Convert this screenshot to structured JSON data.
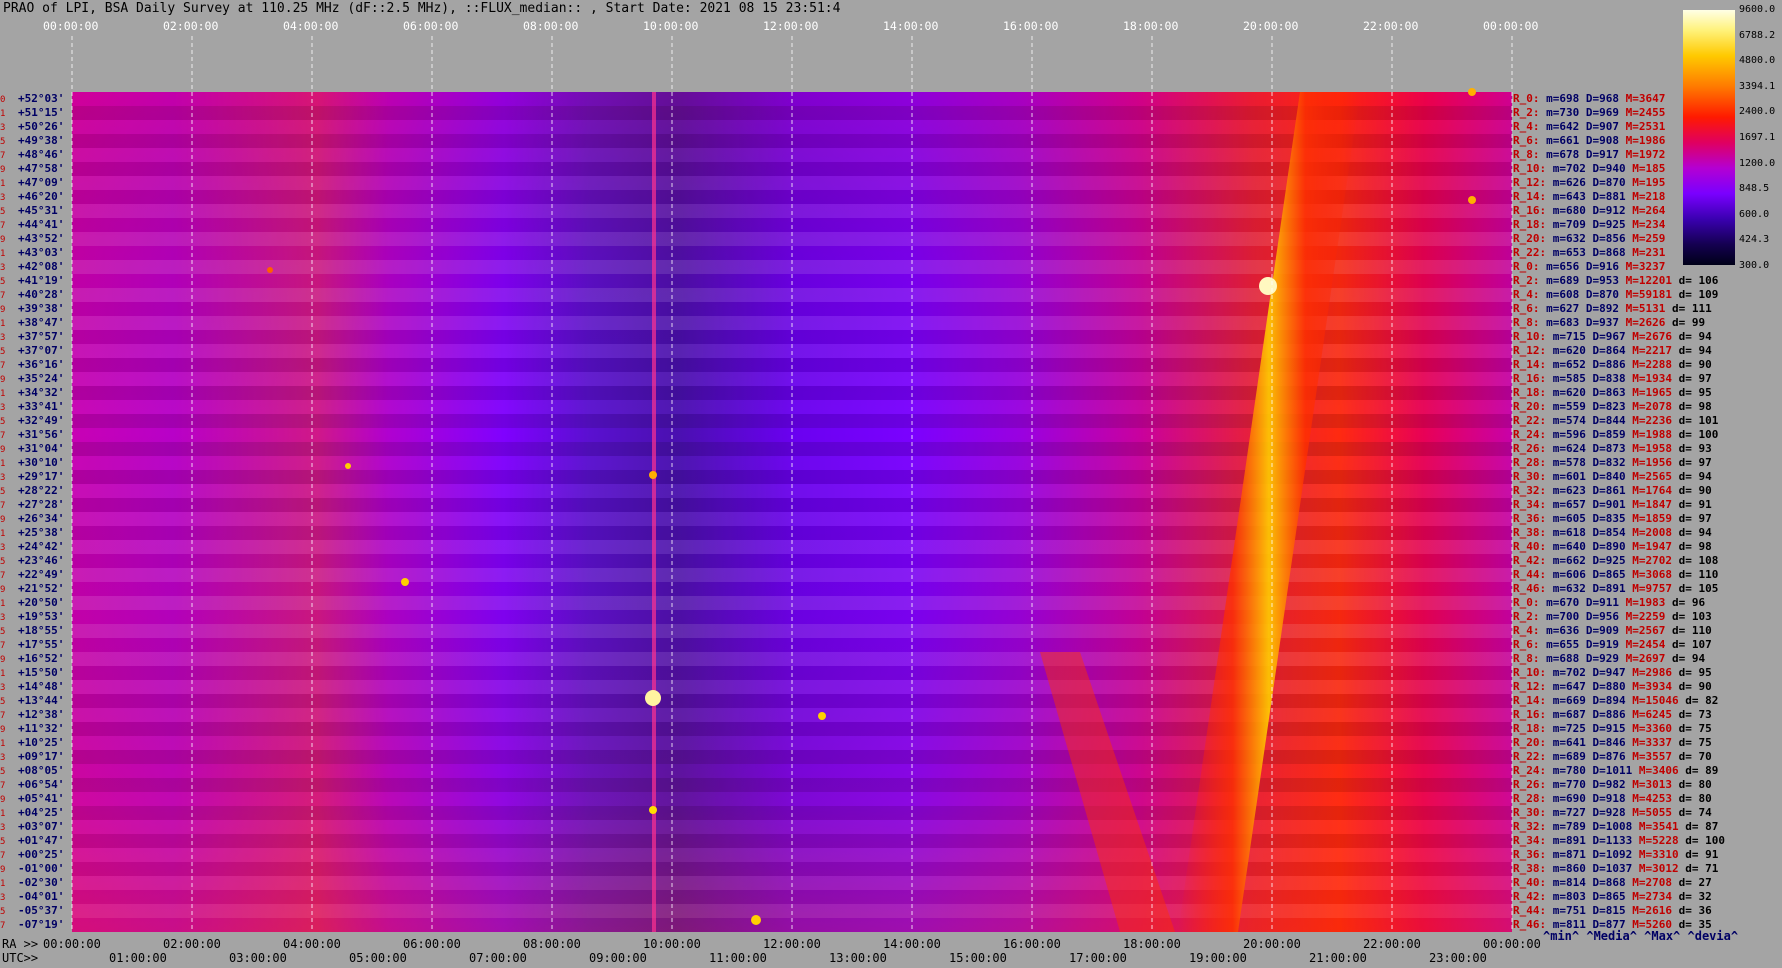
{
  "title": "PRAO of LPI, BSA Daily Survey at 110.25 MHz (dF::2.5 MHz), ::FLUX_median:: , Start Date: 2021 08 15 23:51:4",
  "chart_data": {
    "type": "heatmap",
    "title": "PRAO of LPI, BSA Daily Survey at 110.25 MHz (dF::2.5 MHz), ::FLUX_median:: , Start Date: 2021 08 15 23:51:4",
    "top_time_ticks": [
      "00:00:00",
      "02:00:00",
      "04:00:00",
      "06:00:00",
      "08:00:00",
      "10:00:00",
      "12:00:00",
      "14:00:00",
      "16:00:00",
      "18:00:00",
      "20:00:00",
      "22:00:00",
      "00:00:00"
    ],
    "bottom_ra_ticks": [
      "00:00:00",
      "02:00:00",
      "04:00:00",
      "06:00:00",
      "08:00:00",
      "10:00:00",
      "12:00:00",
      "14:00:00",
      "16:00:00",
      "18:00:00",
      "20:00:00",
      "22:00:00",
      "00:00:00"
    ],
    "bottom_utc_ticks": [
      "01:00:00",
      "03:00:00",
      "05:00:00",
      "07:00:00",
      "09:00:00",
      "11:00:00",
      "13:00:00",
      "15:00:00",
      "17:00:00",
      "19:00:00",
      "21:00:00",
      "23:00:00"
    ],
    "ra_axis_label": "RA >>",
    "utc_axis_label": "UTC>>",
    "colorbar_ticks": [
      "9600.0",
      "6788.2",
      "4800.0",
      "3394.1",
      "2400.0",
      "1697.1",
      "1200.0",
      "848.5",
      "600.0",
      "424.3",
      "300.0"
    ],
    "colorscale": [
      "#000018",
      "#3a00b0",
      "#7a00ff",
      "#b400d2",
      "#e00060",
      "#ff1a00",
      "#ff7a00",
      "#ffc900",
      "#fff27a",
      "#ffffe6"
    ],
    "row_indices": [
      "0",
      "1",
      "3",
      "5",
      "7",
      "9",
      "1",
      "3",
      "5",
      "7",
      "9",
      "1",
      "3",
      "5",
      "7",
      "9",
      "1",
      "3",
      "5",
      "7",
      "9",
      "1",
      "3",
      "5",
      "7",
      "9",
      "1",
      "3",
      "5",
      "7",
      "9",
      "1",
      "3",
      "5",
      "7",
      "9",
      "1",
      "3",
      "5",
      "7",
      "9",
      "1",
      "3",
      "5",
      "7",
      "9",
      "1",
      "3",
      "5",
      "7",
      "9",
      "1",
      "3",
      "5",
      "7",
      "9",
      "1",
      "3",
      "5",
      "7",
      "9"
    ],
    "declinations": [
      "+52°03'",
      "+51°15'",
      "+50°26'",
      "+49°38'",
      "+48°46'",
      "+47°58'",
      "+47°09'",
      "+46°20'",
      "+45°31'",
      "+44°41'",
      "+43°52'",
      "+43°03'",
      "+42°08'",
      "+41°19'",
      "+40°28'",
      "+39°38'",
      "+38°47'",
      "+37°57'",
      "+37°07'",
      "+36°16'",
      "+35°24'",
      "+34°32'",
      "+33°41'",
      "+32°49'",
      "+31°56'",
      "+31°04'",
      "+30°10'",
      "+29°17'",
      "+28°22'",
      "+27°28'",
      "+26°34'",
      "+25°38'",
      "+24°42'",
      "+23°46'",
      "+22°49'",
      "+21°52'",
      "+20°50'",
      "+19°53'",
      "+18°55'",
      "+17°55'",
      "+16°52'",
      "+15°50'",
      "+14°48'",
      "+13°44'",
      "+12°38'",
      "+11°32'",
      "+10°25'",
      "+09°17'",
      "+08°05'",
      "+06°54'",
      "+05°41'",
      "+04°25'",
      "+03°07'",
      "+01°47'",
      "+00°25'",
      "-01°00'",
      "-02°30'",
      "-04°01'",
      "-05°37'",
      "-07°19'"
    ],
    "stats": [
      {
        "name": "R_0:",
        "min": "m=698",
        "med": "D=968",
        "max": "M=3647",
        "dev": ""
      },
      {
        "name": "R_2:",
        "min": "m=730",
        "med": "D=969",
        "max": "M=2455",
        "dev": ""
      },
      {
        "name": "R_4:",
        "min": "m=642",
        "med": "D=907",
        "max": "M=2531",
        "dev": ""
      },
      {
        "name": "R_6:",
        "min": "m=661",
        "med": "D=908",
        "max": "M=1986",
        "dev": ""
      },
      {
        "name": "R_8:",
        "min": "m=678",
        "med": "D=917",
        "max": "M=1972",
        "dev": ""
      },
      {
        "name": "R_10:",
        "min": "m=702",
        "med": "D=940",
        "max": "M=185",
        "dev": ""
      },
      {
        "name": "R_12:",
        "min": "m=626",
        "med": "D=870",
        "max": "M=195",
        "dev": ""
      },
      {
        "name": "R_14:",
        "min": "m=643",
        "med": "D=881",
        "max": "M=218",
        "dev": ""
      },
      {
        "name": "R_16:",
        "min": "m=680",
        "med": "D=912",
        "max": "M=264",
        "dev": ""
      },
      {
        "name": "R_18:",
        "min": "m=709",
        "med": "D=925",
        "max": "M=234",
        "dev": ""
      },
      {
        "name": "R_20:",
        "min": "m=632",
        "med": "D=856",
        "max": "M=259",
        "dev": ""
      },
      {
        "name": "R_22:",
        "min": "m=653",
        "med": "D=868",
        "max": "M=231",
        "dev": ""
      },
      {
        "name": "R_0:",
        "min": "m=656",
        "med": "D=916",
        "max": "M=3237",
        "dev": ""
      },
      {
        "name": "R_2:",
        "min": "m=689",
        "med": "D=953",
        "max": "M=12201",
        "dev": "d= 106"
      },
      {
        "name": "R_4:",
        "min": "m=608",
        "med": "D=870",
        "max": "M=59181",
        "dev": "d= 109"
      },
      {
        "name": "R_6:",
        "min": "m=627",
        "med": "D=892",
        "max": "M=5131",
        "dev": "d= 111"
      },
      {
        "name": "R_8:",
        "min": "m=683",
        "med": "D=937",
        "max": "M=2626",
        "dev": "d= 99"
      },
      {
        "name": "R_10:",
        "min": "m=715",
        "med": "D=967",
        "max": "M=2676",
        "dev": "d= 94"
      },
      {
        "name": "R_12:",
        "min": "m=620",
        "med": "D=864",
        "max": "M=2217",
        "dev": "d= 94"
      },
      {
        "name": "R_14:",
        "min": "m=652",
        "med": "D=886",
        "max": "M=2288",
        "dev": "d= 90"
      },
      {
        "name": "R_16:",
        "min": "m=585",
        "med": "D=838",
        "max": "M=1934",
        "dev": "d= 97"
      },
      {
        "name": "R_18:",
        "min": "m=620",
        "med": "D=863",
        "max": "M=1965",
        "dev": "d= 95"
      },
      {
        "name": "R_20:",
        "min": "m=559",
        "med": "D=823",
        "max": "M=2078",
        "dev": "d= 98"
      },
      {
        "name": "R_22:",
        "min": "m=574",
        "med": "D=844",
        "max": "M=2236",
        "dev": "d= 101"
      },
      {
        "name": "R_24:",
        "min": "m=596",
        "med": "D=859",
        "max": "M=1988",
        "dev": "d= 100"
      },
      {
        "name": "R_26:",
        "min": "m=624",
        "med": "D=873",
        "max": "M=1958",
        "dev": "d= 93"
      },
      {
        "name": "R_28:",
        "min": "m=578",
        "med": "D=832",
        "max": "M=1956",
        "dev": "d= 97"
      },
      {
        "name": "R_30:",
        "min": "m=601",
        "med": "D=840",
        "max": "M=2565",
        "dev": "d= 94"
      },
      {
        "name": "R_32:",
        "min": "m=623",
        "med": "D=861",
        "max": "M=1764",
        "dev": "d= 90"
      },
      {
        "name": "R_34:",
        "min": "m=657",
        "med": "D=901",
        "max": "M=1847",
        "dev": "d= 91"
      },
      {
        "name": "R_36:",
        "min": "m=605",
        "med": "D=835",
        "max": "M=1859",
        "dev": "d= 97"
      },
      {
        "name": "R_38:",
        "min": "m=618",
        "med": "D=854",
        "max": "M=2008",
        "dev": "d= 94"
      },
      {
        "name": "R_40:",
        "min": "m=640",
        "med": "D=890",
        "max": "M=1947",
        "dev": "d= 98"
      },
      {
        "name": "R_42:",
        "min": "m=662",
        "med": "D=925",
        "max": "M=2702",
        "dev": "d= 108"
      },
      {
        "name": "R_44:",
        "min": "m=606",
        "med": "D=865",
        "max": "M=3068",
        "dev": "d= 110"
      },
      {
        "name": "R_46:",
        "min": "m=632",
        "med": "D=891",
        "max": "M=9757",
        "dev": "d= 105"
      },
      {
        "name": "R_0:",
        "min": "m=670",
        "med": "D=911",
        "max": "M=1983",
        "dev": "d= 96"
      },
      {
        "name": "R_2:",
        "min": "m=700",
        "med": "D=956",
        "max": "M=2259",
        "dev": "d= 103"
      },
      {
        "name": "R_4:",
        "min": "m=636",
        "med": "D=909",
        "max": "M=2567",
        "dev": "d= 110"
      },
      {
        "name": "R_6:",
        "min": "m=655",
        "med": "D=919",
        "max": "M=2454",
        "dev": "d= 107"
      },
      {
        "name": "R_8:",
        "min": "m=688",
        "med": "D=929",
        "max": "M=2697",
        "dev": "d= 94"
      },
      {
        "name": "R_10:",
        "min": "m=702",
        "med": "D=947",
        "max": "M=2986",
        "dev": "d= 95"
      },
      {
        "name": "R_12:",
        "min": "m=647",
        "med": "D=880",
        "max": "M=3934",
        "dev": "d= 90"
      },
      {
        "name": "R_14:",
        "min": "m=669",
        "med": "D=894",
        "max": "M=15046",
        "dev": "d= 82"
      },
      {
        "name": "R_16:",
        "min": "m=687",
        "med": "D=886",
        "max": "M=6245",
        "dev": "d= 73"
      },
      {
        "name": "R_18:",
        "min": "m=725",
        "med": "D=915",
        "max": "M=3360",
        "dev": "d= 75"
      },
      {
        "name": "R_20:",
        "min": "m=641",
        "med": "D=846",
        "max": "M=3337",
        "dev": "d= 75"
      },
      {
        "name": "R_22:",
        "min": "m=689",
        "med": "D=876",
        "max": "M=3557",
        "dev": "d= 70"
      },
      {
        "name": "R_24:",
        "min": "m=780",
        "med": "D=1011",
        "max": "M=3406",
        "dev": "d= 89"
      },
      {
        "name": "R_26:",
        "min": "m=770",
        "med": "D=982",
        "max": "M=3013",
        "dev": "d= 80"
      },
      {
        "name": "R_28:",
        "min": "m=690",
        "med": "D=918",
        "max": "M=4253",
        "dev": "d= 80"
      },
      {
        "name": "R_30:",
        "min": "m=727",
        "med": "D=928",
        "max": "M=5055",
        "dev": "d= 74"
      },
      {
        "name": "R_32:",
        "min": "m=789",
        "med": "D=1008",
        "max": "M=3541",
        "dev": "d= 87"
      },
      {
        "name": "R_34:",
        "min": "m=891",
        "med": "D=1133",
        "max": "M=5228",
        "dev": "d= 100"
      },
      {
        "name": "R_36:",
        "min": "m=871",
        "med": "D=1092",
        "max": "M=3310",
        "dev": "d= 91"
      },
      {
        "name": "R_38:",
        "min": "m=860",
        "med": "D=1037",
        "max": "M=3012",
        "dev": "d= 71"
      },
      {
        "name": "R_40:",
        "min": "m=814",
        "med": "D=868",
        "max": "M=2708",
        "dev": "d= 27"
      },
      {
        "name": "R_42:",
        "min": "m=803",
        "med": "D=865",
        "max": "M=2734",
        "dev": "d= 32"
      },
      {
        "name": "R_44:",
        "min": "m=751",
        "med": "D=815",
        "max": "M=2616",
        "dev": "d= 36"
      },
      {
        "name": "R_46:",
        "min": "m=811",
        "med": "D=877",
        "max": "M=5260",
        "dev": "d= 35"
      }
    ],
    "stats_footer": "^min^ ^Media^ ^Max^ ^devia^"
  }
}
